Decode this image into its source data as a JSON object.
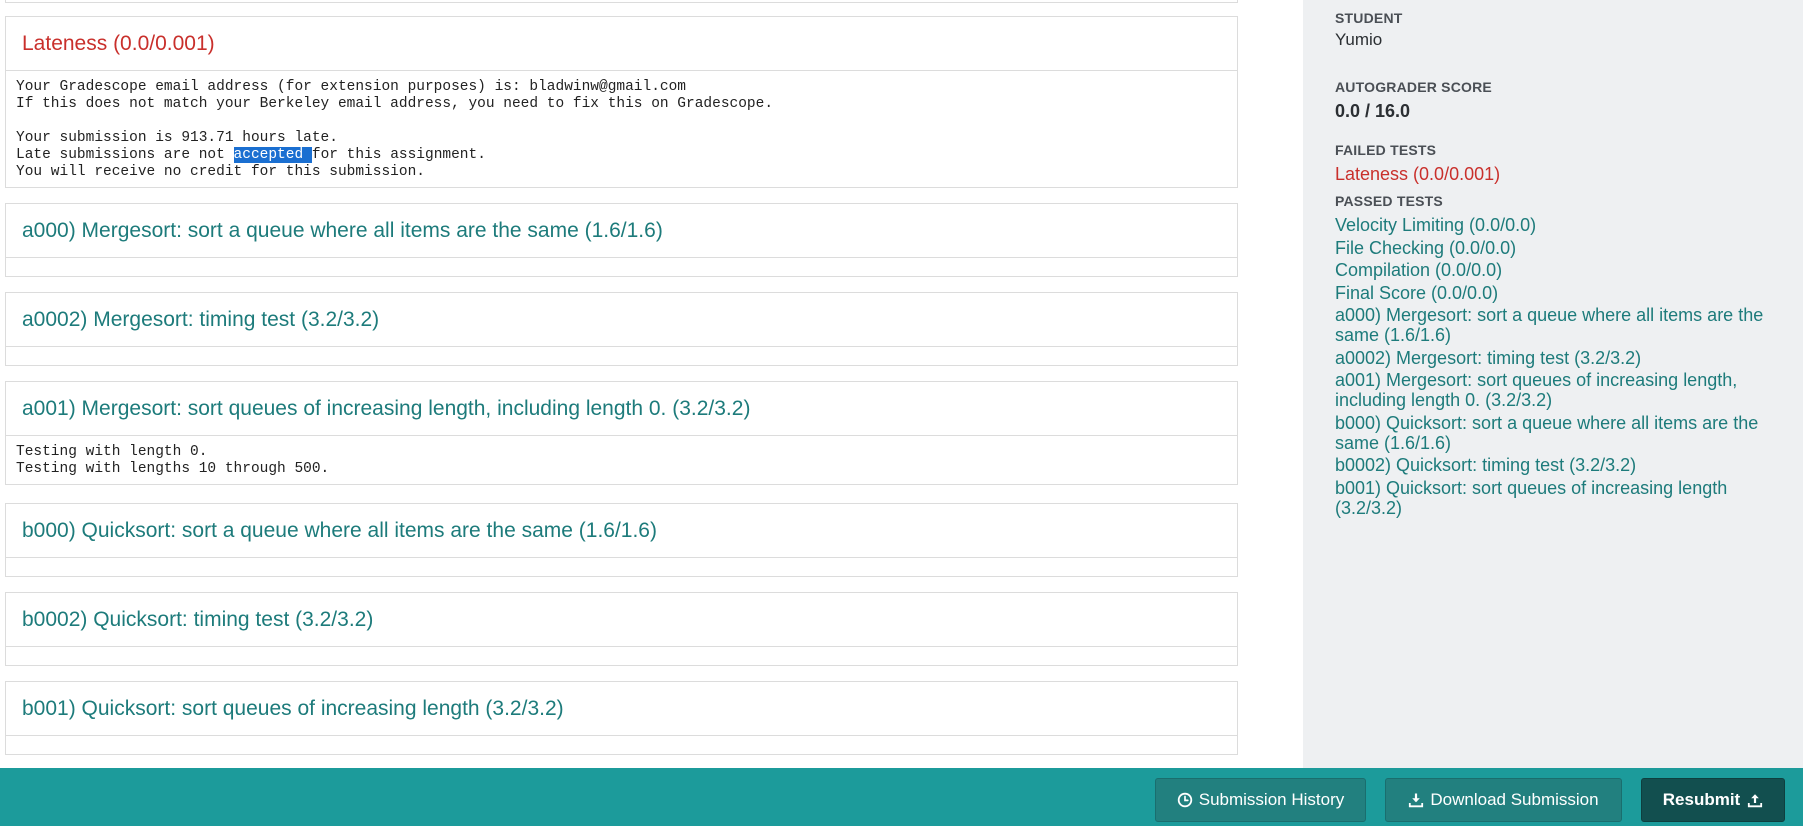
{
  "tests": [
    {
      "title": "Lateness (0.0/0.001)",
      "status": "failed",
      "output_before": "Your Gradescope email address (for extension purposes) is: bladwinw@gmail.com\nIf this does not match your Berkeley email address, you need to fix this on Gradescope.\n\nYour submission is 913.71 hours late.\nLate submissions are not ",
      "output_highlight": "accepted ",
      "output_after": "for this assignment.\nYou will receive no credit for this submission."
    },
    {
      "title": "a000) Mergesort: sort a queue where all items are the same (1.6/1.6)",
      "status": "passed"
    },
    {
      "title": "a0002) Mergesort: timing test (3.2/3.2)",
      "status": "passed"
    },
    {
      "title": "a001) Mergesort: sort queues of increasing length, including length 0. (3.2/3.2)",
      "status": "passed",
      "output": "Testing with length 0.\nTesting with lengths 10 through 500."
    },
    {
      "title": "b000) Quicksort: sort a queue where all items are the same (1.6/1.6)",
      "status": "passed"
    },
    {
      "title": "b0002) Quicksort: timing test (3.2/3.2)",
      "status": "passed"
    },
    {
      "title": "b001) Quicksort: sort queues of increasing length (3.2/3.2)",
      "status": "passed"
    }
  ],
  "sidebar": {
    "student_label": "STUDENT",
    "student_name": "Yumio",
    "score_label": "AUTOGRADER SCORE",
    "score": "0.0 / 16.0",
    "failed_label": "FAILED TESTS",
    "failed_tests": [
      "Lateness (0.0/0.001)"
    ],
    "passed_label": "PASSED TESTS",
    "passed_tests": [
      "Velocity Limiting (0.0/0.0)",
      "File Checking (0.0/0.0)",
      "Compilation (0.0/0.0)",
      "Final Score (0.0/0.0)",
      "a000) Mergesort: sort a queue where all items are the same (1.6/1.6)",
      "a0002) Mergesort: timing test (3.2/3.2)",
      "a001) Mergesort: sort queues of increasing length, including length 0. (3.2/3.2)",
      "b000) Quicksort: sort a queue where all items are the same (1.6/1.6)",
      "b0002) Quicksort: timing test (3.2/3.2)",
      "b001) Quicksort: sort queues of increasing length (3.2/3.2)"
    ]
  },
  "footer": {
    "history_label": "Submission History",
    "history_icon": "clock-icon",
    "download_label": "Download Submission",
    "download_icon": "download-icon",
    "resubmit_label": "Resubmit",
    "resubmit_icon": "upload-icon"
  },
  "colors": {
    "passed": "#1d7b7b",
    "failed": "#c9302c",
    "footer_bg": "#1c9b9b",
    "highlight": "#1a6fd1"
  }
}
